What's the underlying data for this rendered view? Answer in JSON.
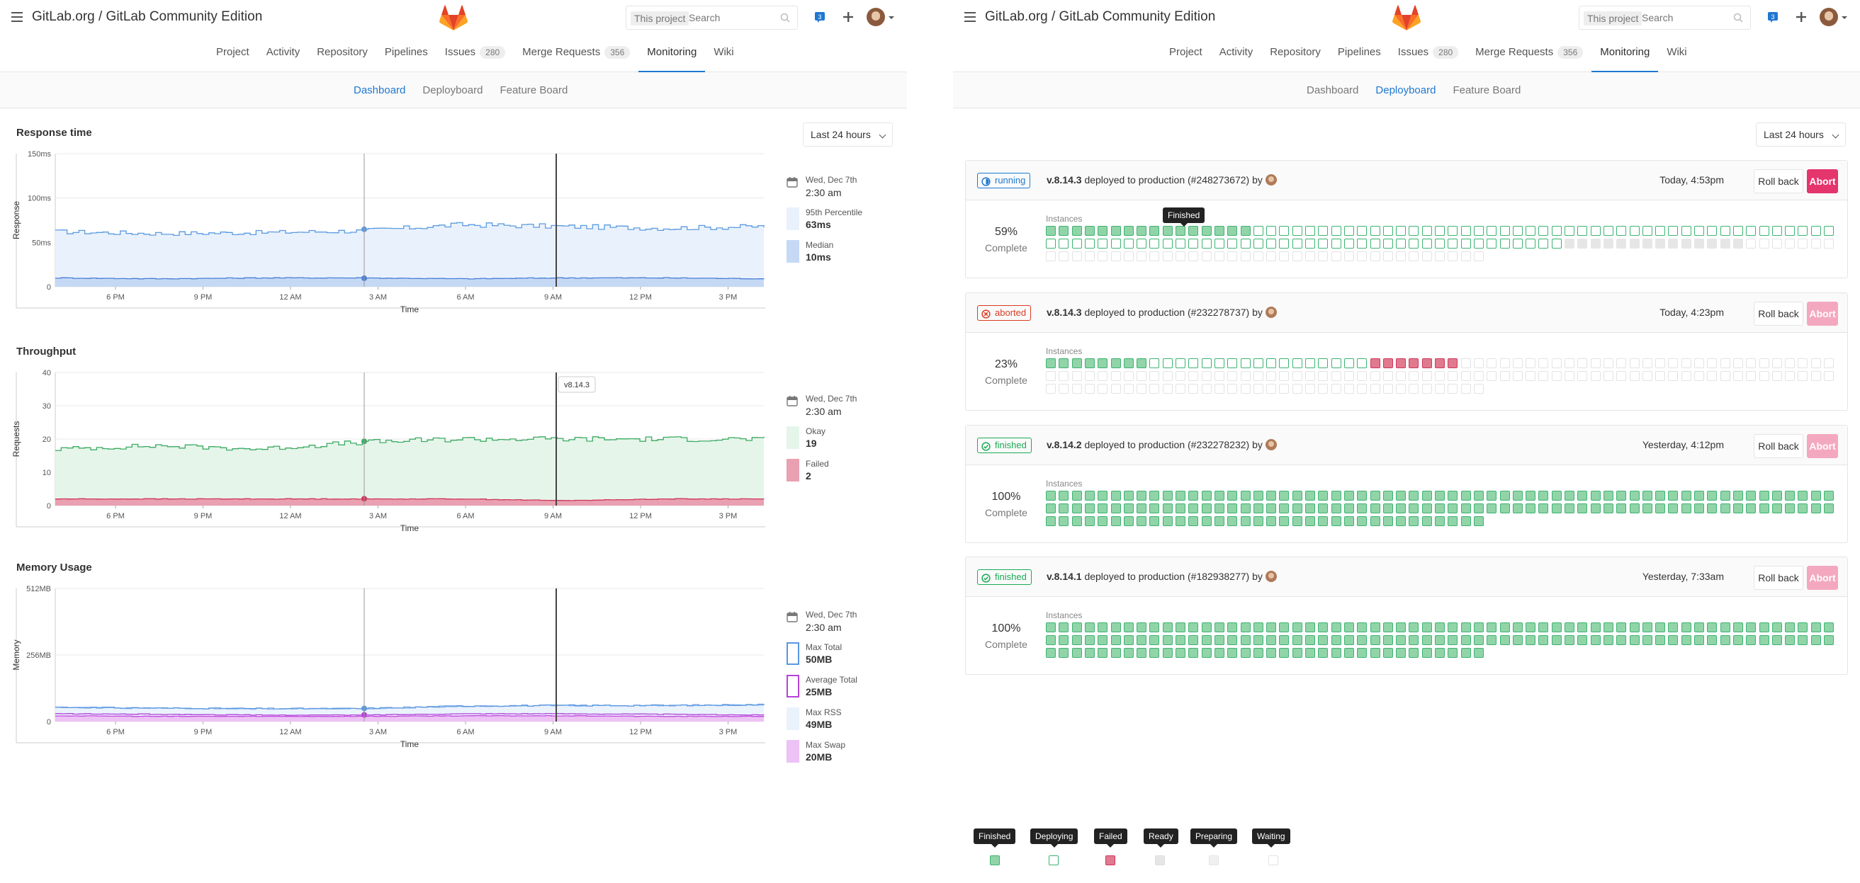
{
  "header": {
    "title": "GitLab.org / GitLab Community Edition",
    "search_scope": "This project",
    "search_placeholder": "Search",
    "todo_count": "3"
  },
  "nav": [
    {
      "label": "Project"
    },
    {
      "label": "Activity"
    },
    {
      "label": "Repository"
    },
    {
      "label": "Pipelines"
    },
    {
      "label": "Issues",
      "badge": "280"
    },
    {
      "label": "Merge Requests",
      "badge": "356"
    },
    {
      "label": "Monitoring",
      "active": true
    },
    {
      "label": "Wiki"
    }
  ],
  "subnav": [
    "Dashboard",
    "Deployboard",
    "Feature Board"
  ],
  "left": {
    "active_subnav": "Dashboard",
    "time_range": "Last 24 hours",
    "charts": [
      {
        "title": "Response time",
        "ylabel": "Response",
        "xlabel": "Time",
        "yticks": [
          "150ms",
          "100ms",
          "50ms",
          "0"
        ],
        "legend_date": "Wed, Dec 7th",
        "legend_time": "2:30 am",
        "legend": [
          {
            "name": "95th Percentile",
            "value": "63ms"
          },
          {
            "name": "Median",
            "value": "10ms"
          }
        ]
      },
      {
        "title": "Throughput",
        "ylabel": "Requests",
        "xlabel": "Time",
        "yticks": [
          "40",
          "30",
          "20",
          "10",
          "0"
        ],
        "legend_date": "Wed, Dec 7th",
        "legend_time": "2:30 am",
        "deploy_label": "v8.14.3",
        "legend": [
          {
            "name": "Okay",
            "value": "19"
          },
          {
            "name": "Failed",
            "value": "2"
          }
        ]
      },
      {
        "title": "Memory Usage",
        "ylabel": "Memory",
        "xlabel": "Time",
        "yticks": [
          "512MB",
          "256MB",
          "0"
        ],
        "legend_date": "Wed, Dec 7th",
        "legend_time": "2:30 am",
        "legend": [
          {
            "name": "Max Total",
            "value": "50MB"
          },
          {
            "name": "Average Total",
            "value": "25MB"
          },
          {
            "name": "Max RSS",
            "value": "49MB"
          },
          {
            "name": "Max Swap",
            "value": "20MB"
          }
        ]
      }
    ],
    "xticks": [
      "6 PM",
      "9 PM",
      "12 AM",
      "3 AM",
      "6 AM",
      "9 AM",
      "12 PM",
      "3 PM"
    ]
  },
  "chart_data": [
    {
      "type": "area",
      "title": "Response time",
      "xlabel": "Time",
      "ylabel": "Response",
      "ylim": [
        0,
        150
      ],
      "categories": [
        "6 PM",
        "9 PM",
        "12 AM",
        "3 AM",
        "6 AM",
        "9 AM",
        "12 PM",
        "3 PM"
      ],
      "series": [
        {
          "name": "95th Percentile",
          "values": [
            62,
            60,
            61,
            63,
            70,
            68,
            66,
            68
          ]
        },
        {
          "name": "Median",
          "values": [
            10,
            9,
            10,
            10,
            9,
            10,
            10,
            9
          ]
        }
      ]
    },
    {
      "type": "area",
      "title": "Throughput",
      "xlabel": "Time",
      "ylabel": "Requests",
      "ylim": [
        0,
        40
      ],
      "categories": [
        "6 PM",
        "9 PM",
        "12 AM",
        "3 AM",
        "6 AM",
        "9 AM",
        "12 PM",
        "3 PM"
      ],
      "series": [
        {
          "name": "Okay",
          "values": [
            17,
            18,
            17,
            19,
            20,
            20,
            20,
            20
          ]
        },
        {
          "name": "Failed",
          "values": [
            2,
            2,
            2,
            2,
            2,
            1.5,
            2,
            2
          ]
        }
      ]
    },
    {
      "type": "area",
      "title": "Memory Usage",
      "xlabel": "Time",
      "ylabel": "Memory",
      "ylim": [
        0,
        512
      ],
      "categories": [
        "6 PM",
        "9 PM",
        "12 AM",
        "3 AM",
        "6 AM",
        "9 AM",
        "12 PM",
        "3 PM"
      ],
      "series": [
        {
          "name": "Max Total",
          "values": [
            55,
            52,
            50,
            50,
            60,
            62,
            62,
            65
          ]
        },
        {
          "name": "Average Total",
          "values": [
            30,
            28,
            25,
            25,
            30,
            30,
            28,
            25
          ]
        },
        {
          "name": "Max RSS",
          "values": [
            54,
            51,
            49,
            49,
            59,
            61,
            61,
            64
          ]
        },
        {
          "name": "Max Swap",
          "values": [
            22,
            20,
            20,
            20,
            22,
            22,
            20,
            20
          ]
        }
      ]
    }
  ],
  "right": {
    "active_subnav": "Deployboard",
    "time_range": "Last 24 hours",
    "instances_label": "Instances",
    "complete_label": "Complete",
    "rollback_label": "Roll back",
    "abort_label": "Abort",
    "by_label": "by",
    "finished_tooltip": "Finished",
    "deployments": [
      {
        "status": "running",
        "version": "v.8.14.3",
        "env_text": "deployed to production (#248273672)",
        "time": "Today, 4:53pm",
        "percent": "59%",
        "abort_enabled": true,
        "instances": {
          "finished": 16,
          "deploying": 85,
          "ready": 14,
          "waiting": 41
        }
      },
      {
        "status": "aborted",
        "version": "v.8.14.3",
        "env_text": "deployed to production (#232278737)",
        "time": "Today, 4:23pm",
        "percent": "23%",
        "abort_enabled": false,
        "instances": {
          "finished": 8,
          "deploying": 17,
          "failed": 7,
          "waiting": 124
        }
      },
      {
        "status": "finished",
        "version": "v.8.14.2",
        "env_text": "deployed to production (#232278232)",
        "time": "Yesterday, 4:12pm",
        "percent": "100%",
        "abort_enabled": false,
        "instances": {
          "finished": 156
        }
      },
      {
        "status": "finished",
        "version": "v.8.14.1",
        "env_text": "deployed to production (#182938277)",
        "time": "Yesterday, 7:33am",
        "percent": "100%",
        "abort_enabled": false,
        "instances": {
          "finished": 156
        }
      }
    ],
    "legend": [
      {
        "label": "Finished"
      },
      {
        "label": "Deploying"
      },
      {
        "label": "Failed"
      },
      {
        "label": "Ready"
      },
      {
        "label": "Preparing"
      },
      {
        "label": "Waiting"
      }
    ]
  },
  "colors": {
    "blue": "#1f78d1",
    "green": "#1aaa55",
    "red": "#db3b21",
    "abort": "#e4356c",
    "abort_disabled": "#f4a8c0",
    "finished_fill": "#91d4a8",
    "finished_border": "#3cb371",
    "failed_fill": "#e07a8f"
  }
}
